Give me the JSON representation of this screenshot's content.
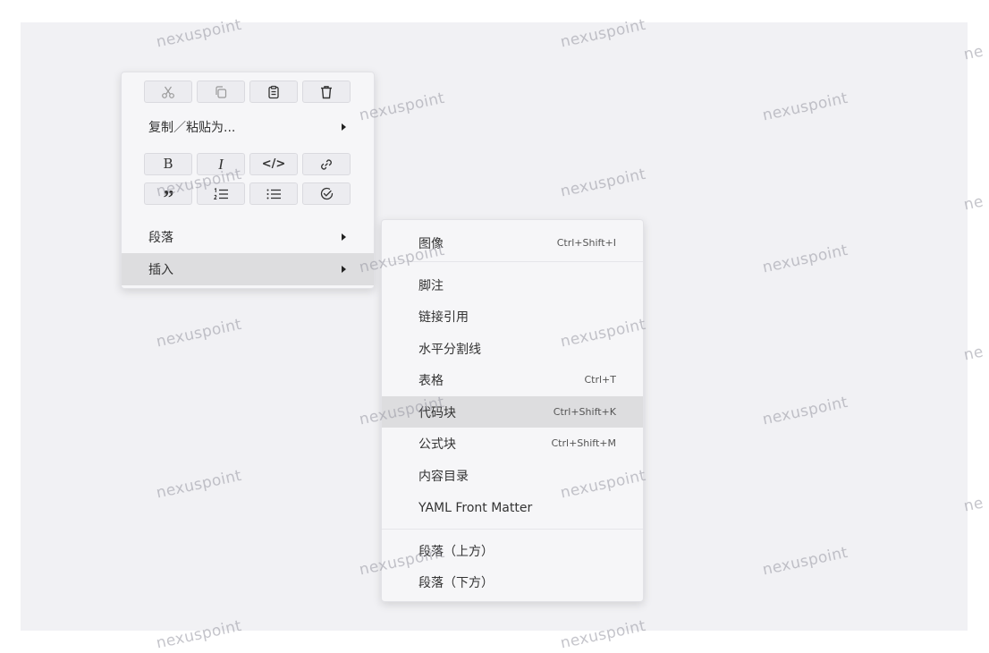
{
  "context_menu": {
    "clipboard_icons": [
      {
        "name": "cut-icon",
        "glyph": "scissors"
      },
      {
        "name": "copy-icon",
        "glyph": "copy"
      },
      {
        "name": "paste-icon",
        "glyph": "clipboard"
      },
      {
        "name": "delete-icon",
        "glyph": "trash"
      }
    ],
    "copy_paste_as_label": "复制／粘贴为...",
    "format_icons_row1": [
      {
        "name": "bold-icon",
        "glyph": "B"
      },
      {
        "name": "italic-icon",
        "glyph": "I"
      },
      {
        "name": "code-icon",
        "glyph": "</>"
      },
      {
        "name": "link-icon",
        "glyph": "link"
      }
    ],
    "format_icons_row2": [
      {
        "name": "quote-icon",
        "glyph": "99"
      },
      {
        "name": "ordered-list-icon",
        "glyph": "ordered-list"
      },
      {
        "name": "unordered-list-icon",
        "glyph": "unordered-list"
      },
      {
        "name": "task-list-icon",
        "glyph": "check-circle"
      }
    ],
    "paragraph_label": "段落",
    "insert_label": "插入"
  },
  "insert_submenu": {
    "items": [
      {
        "label": "图像",
        "shortcut": "Ctrl+Shift+I"
      },
      {
        "label": "脚注",
        "shortcut": ""
      },
      {
        "label": "链接引用",
        "shortcut": ""
      },
      {
        "label": "水平分割线",
        "shortcut": ""
      },
      {
        "label": "表格",
        "shortcut": "Ctrl+T"
      },
      {
        "label": "代码块",
        "shortcut": "Ctrl+Shift+K"
      },
      {
        "label": "公式块",
        "shortcut": "Ctrl+Shift+M"
      },
      {
        "label": "内容目录",
        "shortcut": ""
      },
      {
        "label": "YAML Front Matter",
        "shortcut": ""
      },
      {
        "label": "段落（上方）",
        "shortcut": ""
      },
      {
        "label": "段落（下方）",
        "shortcut": ""
      }
    ],
    "highlighted_item": "代码块"
  },
  "watermark": {
    "text": "nexuspoint",
    "partial_text": "ne"
  },
  "colors": {
    "backdrop": "#f1f1f4",
    "menu_background": "#f6f6f8",
    "highlight": "#dddddf"
  }
}
